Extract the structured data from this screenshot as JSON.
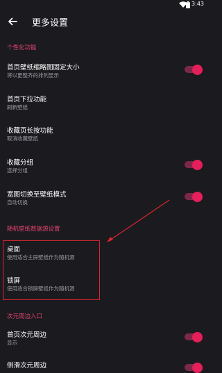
{
  "status_bar": {
    "time": "3:43"
  },
  "app_bar": {
    "title": "更多设置"
  },
  "sections": {
    "personalization": "个性化功能",
    "random_source": "随机壁纸数据源设置",
    "acg": "次元周边入口"
  },
  "rows": {
    "home_thumbnail": {
      "title": "首页壁纸缩略图固定大小",
      "subtitle": "将以更整齐的排列显示",
      "toggle_on": true
    },
    "home_pulldown": {
      "title": "首页下拉功能",
      "subtitle": "刷新壁纸"
    },
    "favorites_longpress": {
      "title": "收藏页长按功能",
      "subtitle": "取消收藏壁纸"
    },
    "favorites_group": {
      "title": "收藏分组",
      "subtitle": "选择分组",
      "toggle_on": true
    },
    "wide_switch": {
      "title": "宽图切换至壁纸模式",
      "subtitle": "自动切换",
      "toggle_on": true
    },
    "desktop": {
      "title": "桌面",
      "subtitle": "使用适合主屏壁纸作为随机源"
    },
    "lockscreen": {
      "title": "锁屏",
      "subtitle": "使用适合锁屏壁纸作为随机源"
    },
    "home_acg": {
      "title": "首页次元周边",
      "subtitle": "显示",
      "toggle_on": true
    },
    "side_acg": {
      "title": "侧滑次元周边"
    }
  },
  "colors": {
    "background": "#1b1a1f",
    "accent": "#e0446f",
    "toggle_knob": "#e61e5a",
    "toggle_track": "#7a2a48",
    "annotation_red": "#d9272e"
  }
}
